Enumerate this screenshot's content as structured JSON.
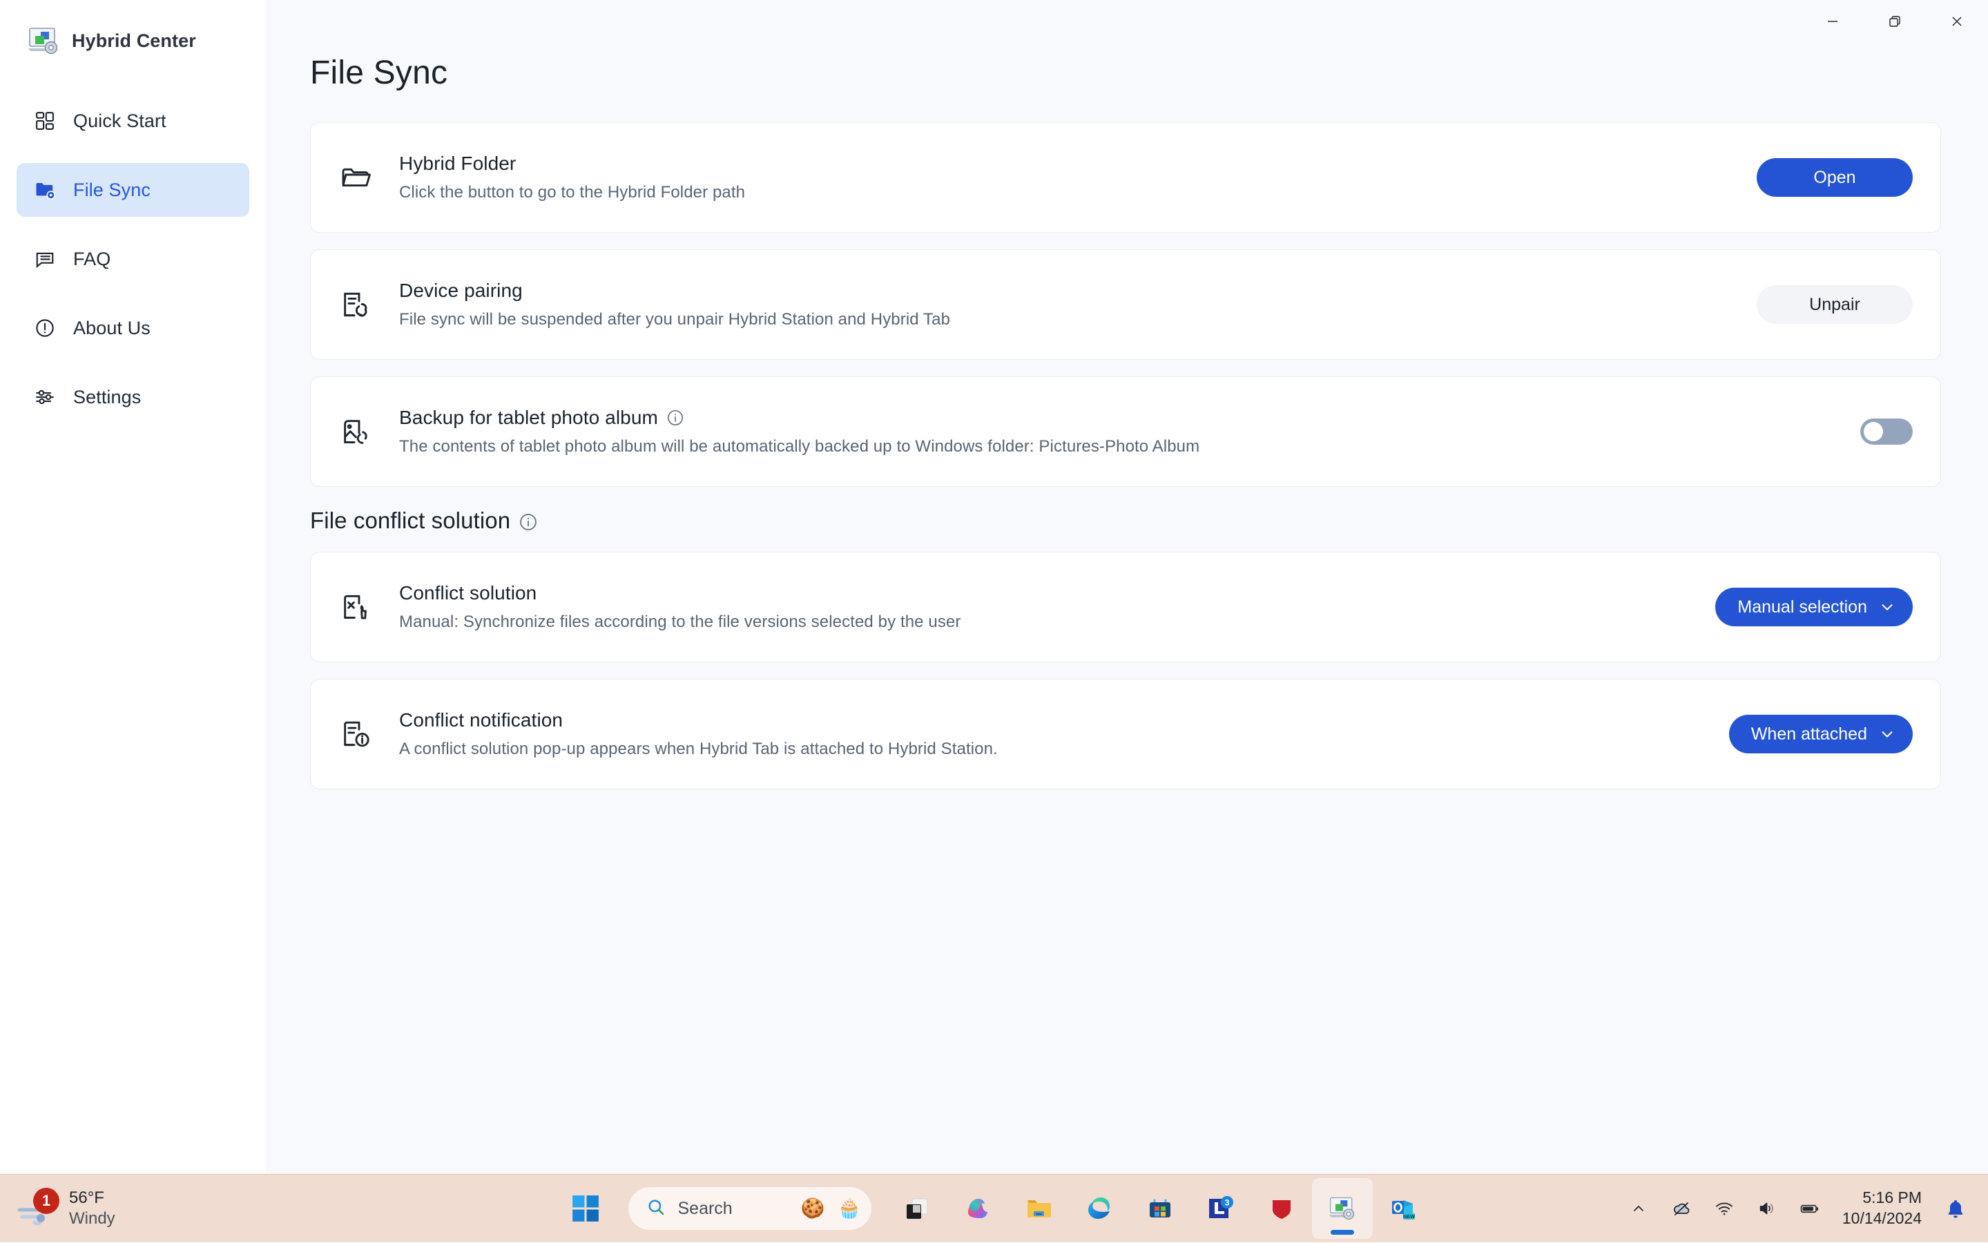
{
  "window": {
    "app_title": "Hybrid Center",
    "app_icon": "hybrid-center-icon",
    "controls": {
      "minimize": "minimize-icon",
      "restore": "restore-icon",
      "close": "close-icon"
    }
  },
  "sidebar": {
    "items": [
      {
        "label": "Quick Start",
        "icon": "grid-icon",
        "active": false
      },
      {
        "label": "File Sync",
        "icon": "folder-sync-icon",
        "active": true
      },
      {
        "label": "FAQ",
        "icon": "chat-bubble-icon",
        "active": false
      },
      {
        "label": "About Us",
        "icon": "info-circle-icon",
        "active": false
      },
      {
        "label": "Settings",
        "icon": "sliders-icon",
        "active": false
      }
    ]
  },
  "main": {
    "page_title": "File Sync",
    "cards": [
      {
        "icon": "folder-icon",
        "title": "Hybrid Folder",
        "desc": "Click the button to go to the Hybrid Folder path",
        "action": {
          "type": "primary-button",
          "label": "Open"
        }
      },
      {
        "icon": "device-pairing-icon",
        "title": "Device pairing",
        "desc": "File sync will be suspended after you unpair Hybrid Station and Hybrid Tab",
        "action": {
          "type": "ghost-button",
          "label": "Unpair"
        }
      },
      {
        "icon": "photo-backup-icon",
        "title": "Backup for tablet photo album",
        "has_info": true,
        "desc": "The contents of tablet photo album will be automatically backed up to Windows folder: Pictures-Photo Album",
        "action": {
          "type": "toggle",
          "state": "off"
        }
      }
    ],
    "section": {
      "heading": "File conflict solution",
      "has_info": true,
      "cards": [
        {
          "icon": "conflict-solution-icon",
          "title": "Conflict solution",
          "desc": "Manual: Synchronize files according to the file versions selected by the user",
          "action": {
            "type": "dropdown-button",
            "label": "Manual selection"
          }
        },
        {
          "icon": "conflict-notification-icon",
          "title": "Conflict notification",
          "desc": "A conflict solution pop-up appears when Hybrid Tab is attached to Hybrid Station.",
          "action": {
            "type": "dropdown-button",
            "label": "When attached"
          }
        }
      ]
    }
  },
  "taskbar": {
    "weather": {
      "icon": "windy-icon",
      "badge": "1",
      "temperature": "56°F",
      "condition": "Windy"
    },
    "start": {
      "icon": "windows-start-icon"
    },
    "search": {
      "icon": "search-icon",
      "placeholder": "Search",
      "emoji_left": "🍪",
      "emoji_right": "🧁"
    },
    "apps": [
      {
        "name": "task-view-icon",
        "label": "Task View"
      },
      {
        "name": "copilot-icon",
        "label": "Copilot"
      },
      {
        "name": "file-explorer-icon",
        "label": "File Explorer"
      },
      {
        "name": "edge-icon",
        "label": "Microsoft Edge"
      },
      {
        "name": "microsoft-store-icon",
        "label": "Microsoft Store"
      },
      {
        "name": "lenovo-icon",
        "label": "Lenovo",
        "badge": "3"
      },
      {
        "name": "mcafee-icon",
        "label": "McAfee"
      },
      {
        "name": "hybrid-center-taskbar-icon",
        "label": "Hybrid Center",
        "active": true
      },
      {
        "name": "outlook-new-icon",
        "label": "Outlook",
        "badge_text": "NEW"
      }
    ],
    "tray": {
      "overflow": "chevron-up-icon",
      "onedrive": "onedrive-offline-icon",
      "wifi": "wifi-icon",
      "volume": "volume-icon",
      "battery": "battery-icon",
      "time": "5:16 PM",
      "date": "10/14/2024",
      "notifications": "bell-icon"
    }
  },
  "colors": {
    "accent_blue": "#2454d4",
    "sidebar_active_bg": "#d9e7fb",
    "toggle_off": "#94a4bd",
    "taskbar_bg": "#f0dcd0",
    "page_bg": "#f7f9fc"
  }
}
